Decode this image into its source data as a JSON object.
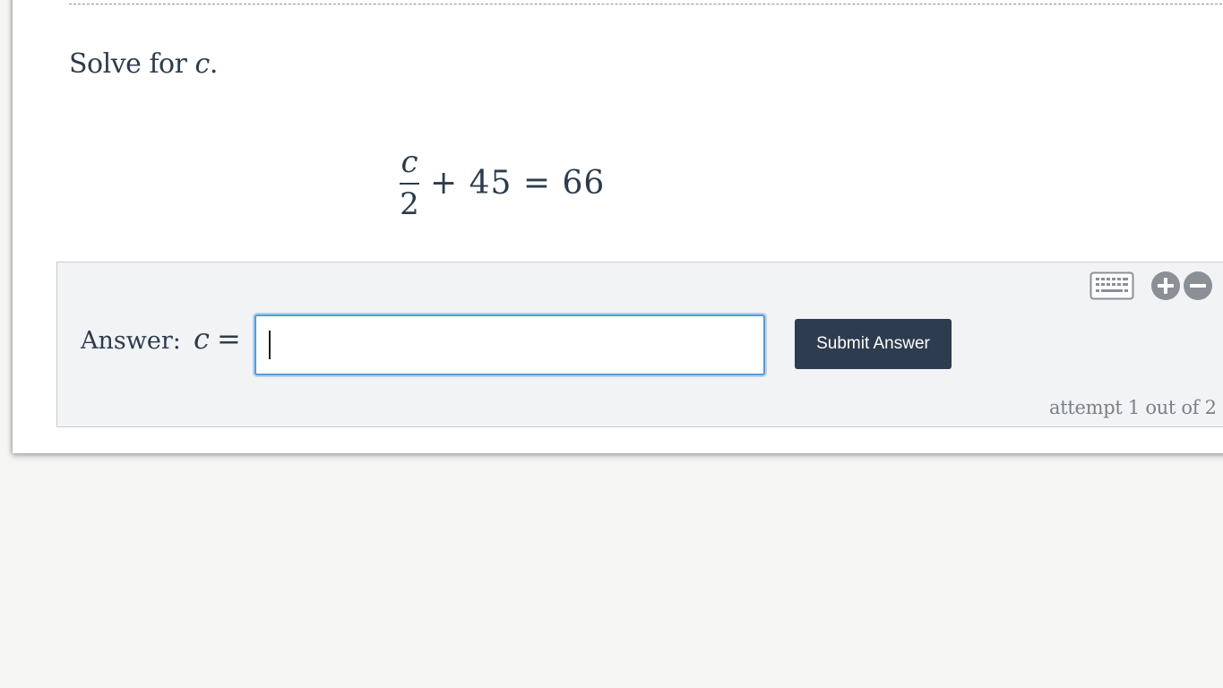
{
  "question": {
    "prompt_prefix": "Solve for ",
    "prompt_variable": "c",
    "prompt_suffix": ".",
    "equation": {
      "numerator": "c",
      "denominator": "2",
      "rest": "+ 45 = 66"
    }
  },
  "answer_panel": {
    "label": "Answer:",
    "variable": "c",
    "equals": "=",
    "input_value": "",
    "submit_label": "Submit Answer",
    "attempt_text": "attempt 1 out of 2",
    "icons": {
      "keyboard": "keyboard-icon",
      "zoom_in": "plus-circle-icon",
      "zoom_out": "minus-circle-icon"
    }
  },
  "colors": {
    "text": "#2d3b4c",
    "button": "#2d3c4e",
    "input_focus": "#5a9bd8",
    "panel_bg": "#f2f3f5",
    "muted": "#7b8087"
  }
}
